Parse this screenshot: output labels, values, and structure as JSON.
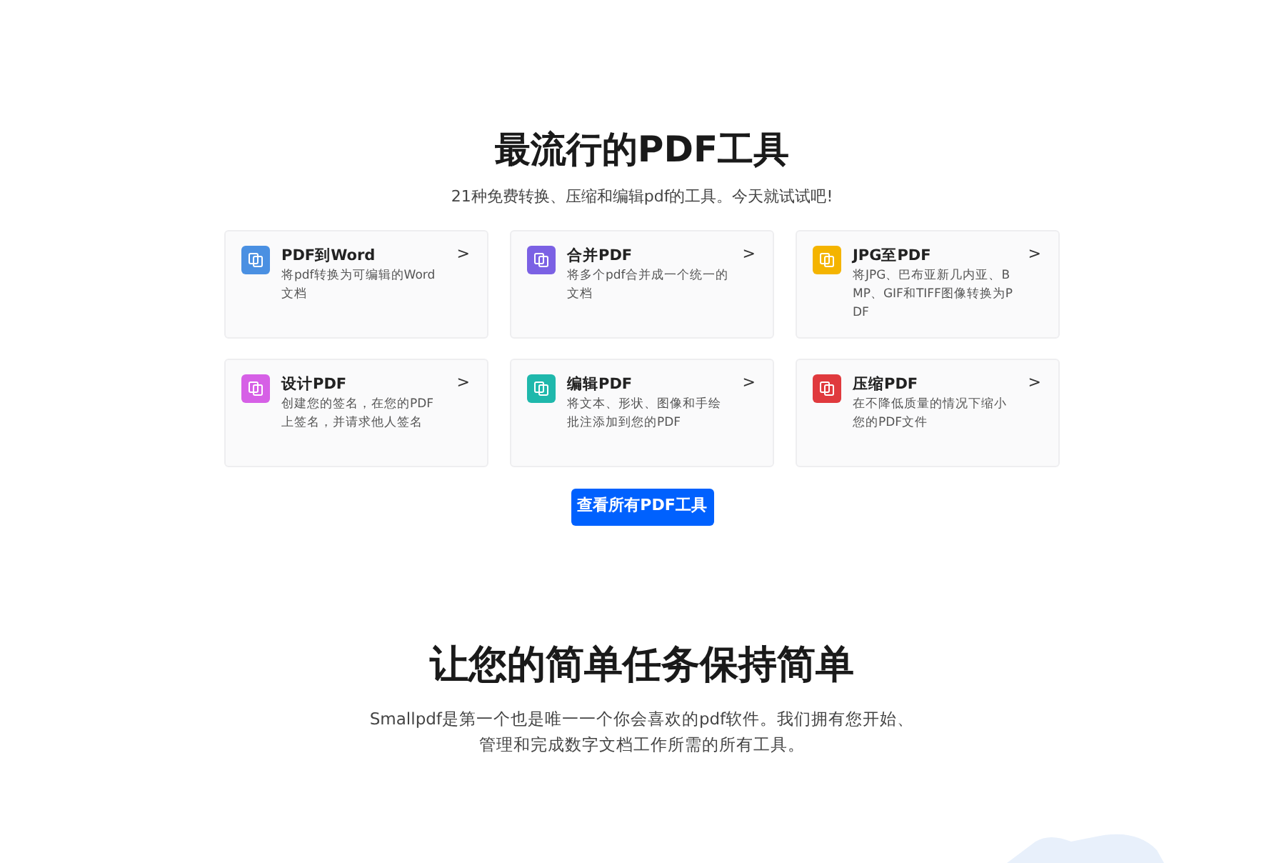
{
  "tools_section": {
    "title": "最流行的PDF工具",
    "subtitle": "21种免费转换、压缩和编辑pdf的工具。今天就试试吧!",
    "tools": [
      {
        "name": "PDF到Word",
        "description": "将pdf转换为可编辑的Word文档",
        "color": "#4a90e2",
        "chevron": ">"
      },
      {
        "name": "合并PDF",
        "description": "将多个pdf合并成一个统一的文档",
        "color": "#7b61e4",
        "chevron": ">"
      },
      {
        "name": "JPG至PDF",
        "description": "将JPG、巴布亚新几内亚、BMP、GIF和TIFF图像转换为PDF",
        "color": "#f4b400",
        "chevron": ">"
      },
      {
        "name": "设计PDF",
        "description": "创建您的签名，在您的PDF上签名，并请求他人签名",
        "color": "#d660e6",
        "chevron": ">"
      },
      {
        "name": "编辑PDF",
        "description": "将文本、形状、图像和手绘批注添加到您的PDF",
        "color": "#1fb8ac",
        "chevron": ">"
      },
      {
        "name": "压缩PDF",
        "description": "在不降低质量的情况下缩小您的PDF文件",
        "color": "#e03a3e",
        "chevron": ">"
      }
    ],
    "button": "查看所有PDF工具"
  },
  "intro_section": {
    "title": "让您的简单任务保持简单",
    "paragraph": "Smallpdf是第一个也是唯一一个你会喜欢的pdf软件。我们拥有您开始、管理和完成数字文档工作所需的所有工具。"
  }
}
